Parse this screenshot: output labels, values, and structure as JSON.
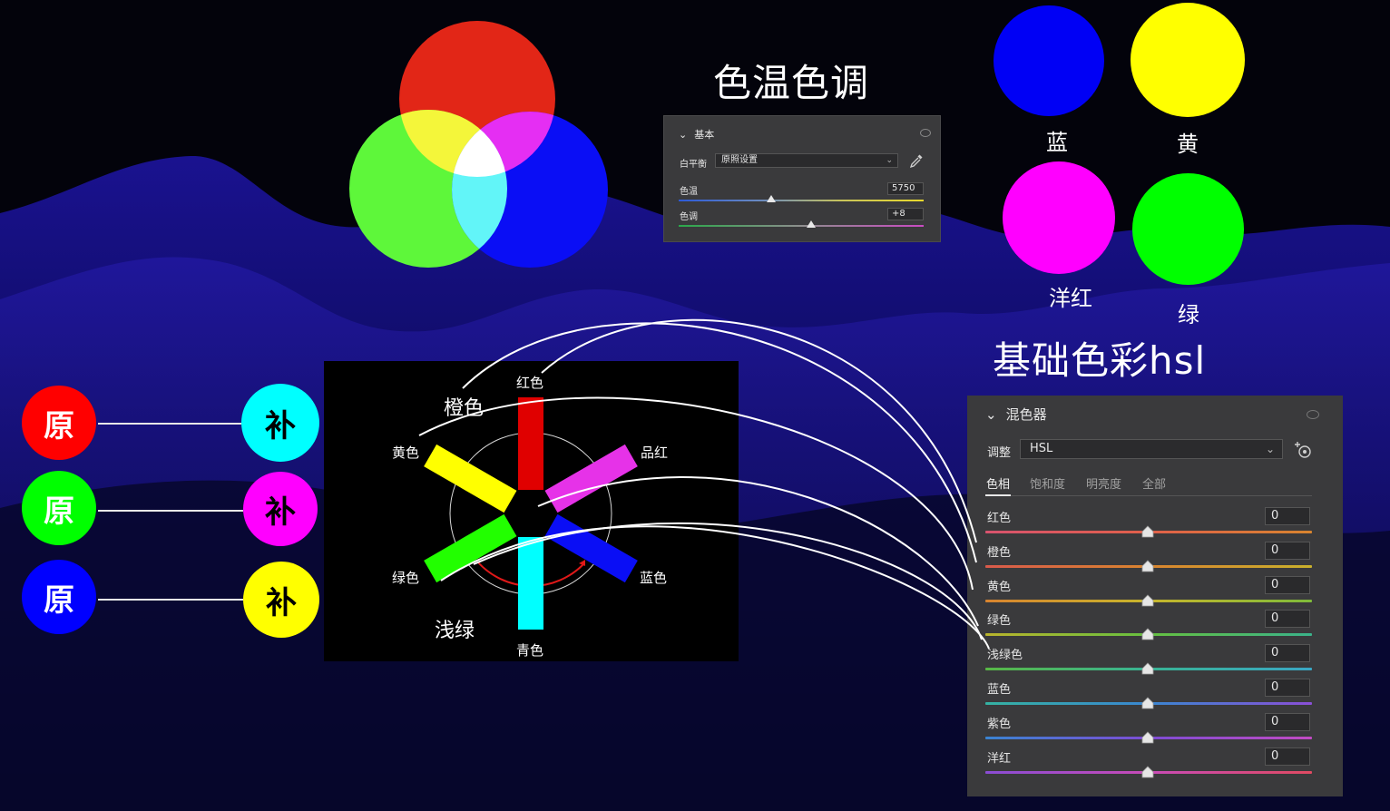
{
  "slide": {
    "temp_tint_title": "色温色调",
    "hsl_title": "基础色彩hsl"
  },
  "colors": {
    "red": "#e22617",
    "green": "#5ef73a",
    "blue": "#0a0ef5",
    "yellow": "#ffff00",
    "magenta": "#ff00ff",
    "cyan": "#00ffff",
    "pure_green": "#00ff00"
  },
  "basic_panel": {
    "header": "基本",
    "white_balance_label": "白平衡",
    "white_balance_value": "原照设置",
    "temp_label": "色温",
    "temp_value": "5750",
    "tint_label": "色调",
    "tint_value": "+8"
  },
  "color_circles": [
    {
      "label": "蓝",
      "color": "#0000f5"
    },
    {
      "label": "黄",
      "color": "#ffff00"
    },
    {
      "label": "洋红",
      "color": "#ff00ff"
    },
    {
      "label": "绿",
      "color": "#00ff00"
    }
  ],
  "complement_pairs": [
    {
      "primary_label": "原",
      "primary_color": "#ff0000",
      "comp_label": "补",
      "comp_color": "#00ffff"
    },
    {
      "primary_label": "原",
      "primary_color": "#00ff00",
      "comp_label": "补",
      "comp_color": "#ff00ff"
    },
    {
      "primary_label": "原",
      "primary_color": "#0000ff",
      "comp_label": "补",
      "comp_color": "#ffff00"
    }
  ],
  "wheel": {
    "red": "红色",
    "magenta": "品红",
    "blue": "蓝色",
    "cyan": "青色",
    "green": "绿色",
    "yellow": "黄色",
    "orange": "橙色",
    "aqua": "浅绿"
  },
  "mixer": {
    "header": "混色器",
    "adjust_label": "调整",
    "adjust_value": "HSL",
    "tabs": [
      "色相",
      "饱和度",
      "明亮度",
      "全部"
    ],
    "active_tab": 0,
    "rows": [
      {
        "label": "红色",
        "value": "0",
        "gradient": [
          "#d8536e",
          "#e0604a",
          "#d8842f"
        ]
      },
      {
        "label": "橙色",
        "value": "0",
        "gradient": [
          "#d95a4b",
          "#d9842f",
          "#c9b02c"
        ]
      },
      {
        "label": "黄色",
        "value": "0",
        "gradient": [
          "#d8842f",
          "#c7b52c",
          "#7fbb3a"
        ]
      },
      {
        "label": "绿色",
        "value": "0",
        "gradient": [
          "#b9b42c",
          "#66c040",
          "#3ab38a"
        ]
      },
      {
        "label": "浅绿色",
        "value": "0",
        "gradient": [
          "#58b845",
          "#38b394",
          "#3aa7c4"
        ]
      },
      {
        "label": "蓝色",
        "value": "0",
        "gradient": [
          "#35b2a2",
          "#3a86d0",
          "#8a4fd6"
        ]
      },
      {
        "label": "紫色",
        "value": "0",
        "gradient": [
          "#3a84d2",
          "#7d4cd4",
          "#c24bc3"
        ]
      },
      {
        "label": "洋红",
        "value": "0",
        "gradient": [
          "#8a4cd4",
          "#c84bb8",
          "#e04a62"
        ]
      }
    ]
  }
}
